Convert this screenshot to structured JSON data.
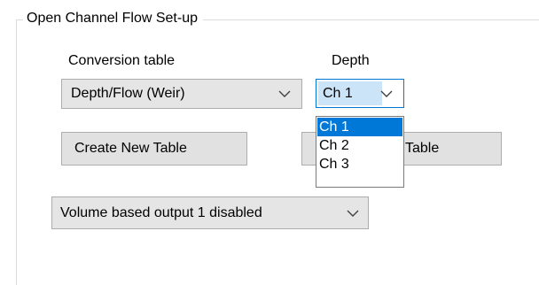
{
  "group": {
    "title": "Open Channel Flow Set-up"
  },
  "conversion_table": {
    "label": "Conversion table",
    "selected": "Depth/Flow (Weir)"
  },
  "depth": {
    "label": "Depth",
    "selected": "Ch 1",
    "dropdown_open": true,
    "options": [
      "Ch 1",
      "Ch 2",
      "Ch 3"
    ],
    "highlighted_option": "Ch 1"
  },
  "buttons": {
    "create_new_table": "Create New Table",
    "second_table_visible": "Table"
  },
  "volume_output": {
    "selected": "Volume based output 1 disabled"
  },
  "colors": {
    "accent": "#0078d7",
    "selection_fill": "#cce4f7",
    "combo_bg": "#e5e5e5",
    "button_bg": "#e1e1e1",
    "groupbox_border": "#dcdcdc"
  },
  "icons": {
    "dropdown_arrow": "chevron-down-icon"
  }
}
